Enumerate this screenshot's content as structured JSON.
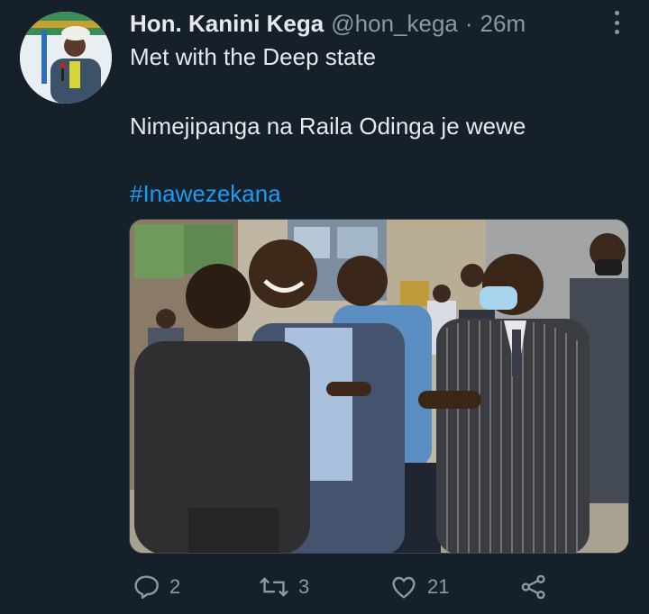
{
  "author": {
    "display_name": "Hon. Kanini Kega",
    "handle": "@hon_kega",
    "separator": "·",
    "time_ago": "26m"
  },
  "tweet": {
    "line1": "Met with the Deep state",
    "line2": "Nimejipanga na Raila Odinga je wewe",
    "hashtag": "#Inawezekana"
  },
  "actions": {
    "reply_count": "2",
    "retweet_count": "3",
    "like_count": "21"
  },
  "colors": {
    "background": "#15202b",
    "text": "#e7e9ea",
    "muted": "#8b98a5",
    "accent": "#1d9bf0"
  },
  "icons": [
    "more-options-icon",
    "reply-icon",
    "retweet-icon",
    "like-icon",
    "share-icon"
  ]
}
